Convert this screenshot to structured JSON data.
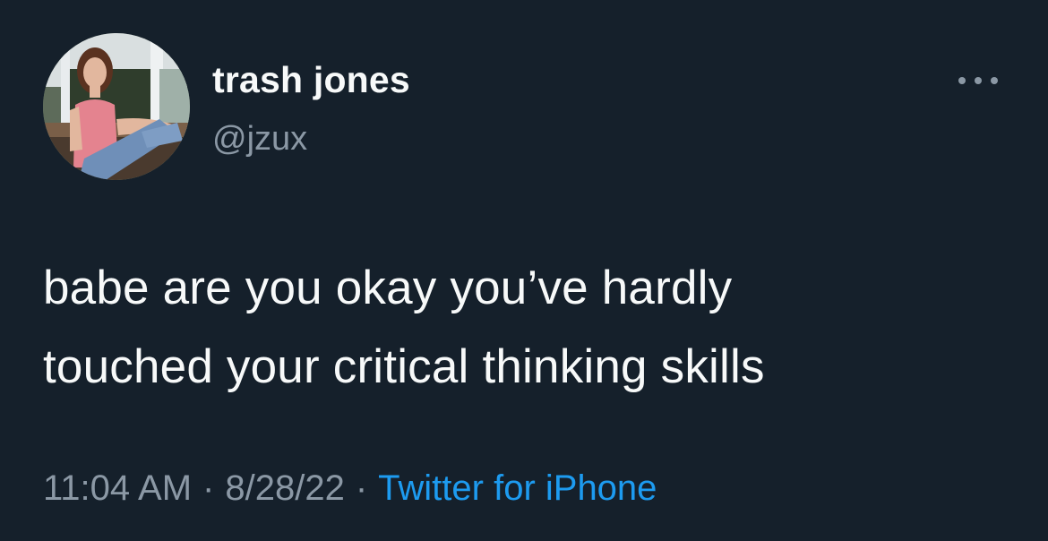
{
  "user": {
    "display_name": "trash jones",
    "handle": "@jzux"
  },
  "tweet": {
    "text_lines": [
      "babe are you okay you’ve hardly",
      "touched your critical thinking skills"
    ]
  },
  "meta": {
    "time": "11:04 AM",
    "date": "8/28/22",
    "separator": "·",
    "source": "Twitter for iPhone"
  },
  "icons": {
    "more": "more-options-icon",
    "avatar": "profile-photo"
  },
  "colors": {
    "background": "#15202b",
    "text_primary": "#f7f9f9",
    "text_secondary": "#8b98a5",
    "link": "#1d9bf0"
  }
}
